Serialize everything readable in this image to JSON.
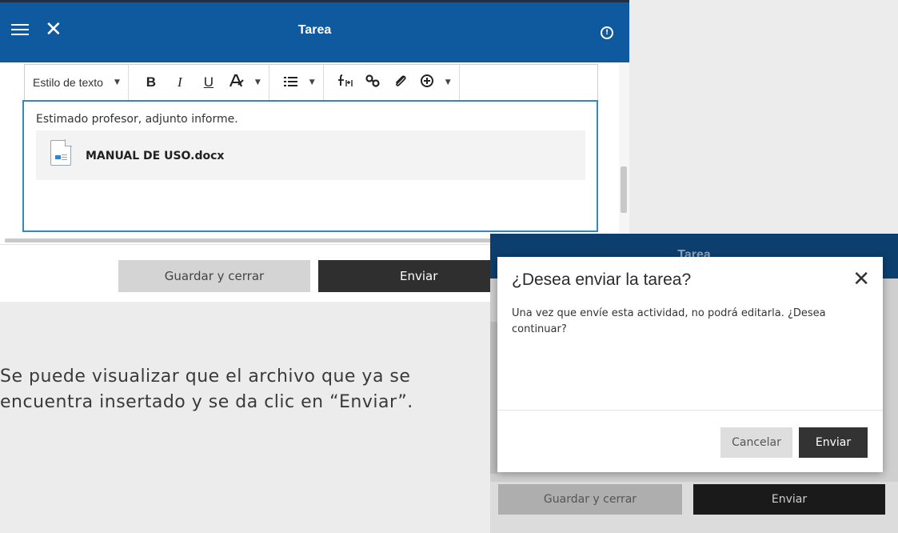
{
  "editor_window": {
    "title": "Tarea",
    "toolbar": {
      "text_style_label": "Estilo de texto",
      "bold": "B",
      "italic": "I",
      "underline": "U"
    },
    "message": "Estimado profesor, adjunto informe.",
    "attachment_name": "MANUAL DE USO.docx",
    "save_close_label": "Guardar y cerrar",
    "send_label": "Enviar"
  },
  "caption": "Se puede visualizar que el archivo que ya se encuentra insertado y se da clic en “Enviar”.",
  "confirm_window": {
    "background_title": "Tarea",
    "modal": {
      "title": "¿Desea enviar la tarea?",
      "body": "Una vez que envíe esta actividad, no podrá editarla. ¿Desea continuar?",
      "cancel_label": "Cancelar",
      "send_label": "Enviar"
    },
    "background_save_label": "Guardar y cerrar",
    "background_send_label": "Enviar"
  },
  "icons": [
    "menu-icon",
    "close-icon",
    "info-icon",
    "list-icon",
    "formula-icon",
    "link-icon",
    "paperclip-icon",
    "add-circle-icon",
    "document-icon"
  ],
  "colors": {
    "header_blue": "#0f5a9e",
    "editor_focus": "#2e87c9",
    "dark_button": "#2f2f2f"
  }
}
